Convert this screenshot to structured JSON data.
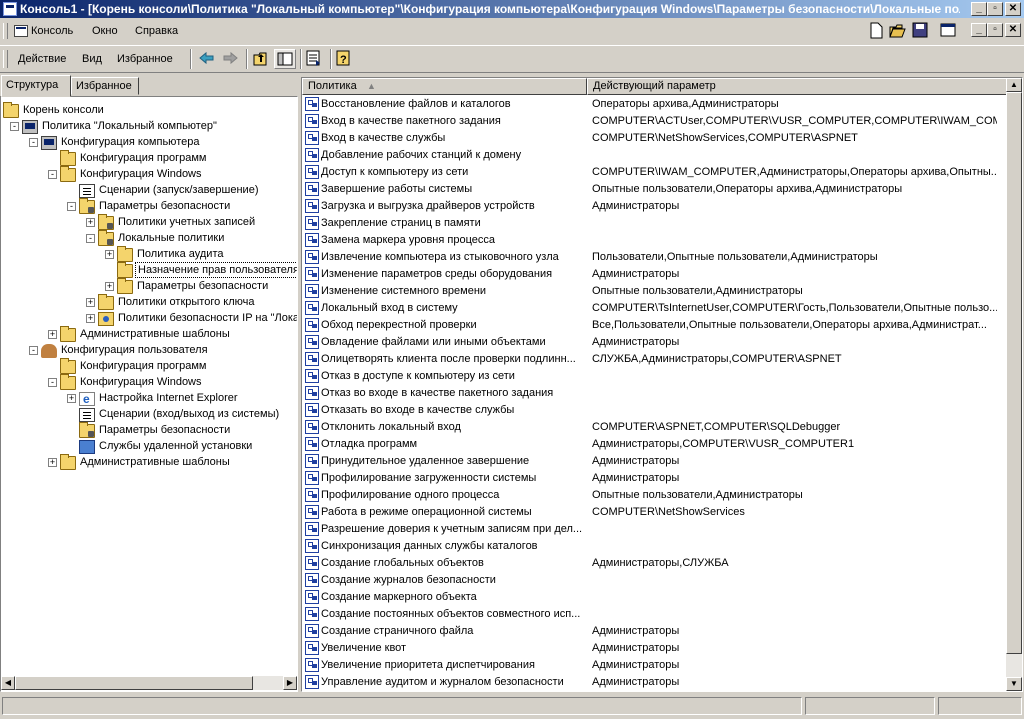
{
  "window": {
    "title": "Консоль1 - [Корень консоли\\Политика \"Локальный компьютер\"\\Конфигурация компьютера\\Конфигурация Windows\\Параметры безопасности\\Локальные пол..."
  },
  "menu": {
    "console": "Консоль",
    "window": "Окно",
    "help": "Справка"
  },
  "toolbar": {
    "action": "Действие",
    "view": "Вид",
    "favorites": "Избранное"
  },
  "tabs": {
    "structure": "Структура",
    "favorites": "Избранное"
  },
  "tree": [
    {
      "label": "Корень консоли",
      "icon": "folder-icon",
      "expander": ""
    },
    {
      "label": "Политика \"Локальный компьютер\"",
      "icon": "computer-icon",
      "expander": "-"
    },
    {
      "label": "Конфигурация компьютера",
      "icon": "computer-icon",
      "expander": "-"
    },
    {
      "label": "Конфигурация программ",
      "icon": "folder-icon",
      "expander": ""
    },
    {
      "label": "Конфигурация Windows",
      "icon": "folder-icon",
      "expander": "-"
    },
    {
      "label": "Сценарии (запуск/завершение)",
      "icon": "script-icon",
      "expander": ""
    },
    {
      "label": "Параметры безопасности",
      "icon": "security-folder-icon",
      "expander": "-"
    },
    {
      "label": "Политики учетных записей",
      "icon": "security-folder-icon",
      "expander": "+"
    },
    {
      "label": "Локальные политики",
      "icon": "security-folder-icon",
      "expander": "-"
    },
    {
      "label": "Политика аудита",
      "icon": "folder-icon",
      "expander": "+"
    },
    {
      "label": "Назначение прав пользователя",
      "icon": "folder-icon",
      "expander": "",
      "selected": true
    },
    {
      "label": "Параметры безопасности",
      "icon": "folder-icon",
      "expander": "+"
    },
    {
      "label": "Политики открытого ключа",
      "icon": "folder-icon",
      "expander": "+"
    },
    {
      "label": "Политики безопасности IP на \"Лока",
      "icon": "ipsec-icon",
      "expander": "+"
    },
    {
      "label": "Административные шаблоны",
      "icon": "folder-icon",
      "expander": "+"
    },
    {
      "label": "Конфигурация пользователя",
      "icon": "user-icon",
      "expander": "-"
    },
    {
      "label": "Конфигурация программ",
      "icon": "folder-icon",
      "expander": ""
    },
    {
      "label": "Конфигурация Windows",
      "icon": "folder-icon",
      "expander": "-"
    },
    {
      "label": "Настройка Internet Explorer",
      "icon": "ie-icon",
      "expander": "+"
    },
    {
      "label": "Сценарии (вход/выход из системы)",
      "icon": "script-icon",
      "expander": ""
    },
    {
      "label": "Параметры безопасности",
      "icon": "security-folder-icon",
      "expander": ""
    },
    {
      "label": "Службы удаленной установки",
      "icon": "network-icon",
      "expander": ""
    },
    {
      "label": "Административные шаблоны",
      "icon": "folder-icon",
      "expander": "+"
    }
  ],
  "list": {
    "col_policy": "Политика",
    "col_value": "Действующий параметр",
    "rows": [
      {
        "policy": "Восстановление файлов и каталогов",
        "value": "Операторы архива,Администраторы"
      },
      {
        "policy": "Вход в качестве пакетного задания",
        "value": "COMPUTER\\ACTUser,COMPUTER\\VUSR_COMPUTER,COMPUTER\\IWAM_COMPUT..."
      },
      {
        "policy": "Вход в качестве службы",
        "value": "COMPUTER\\NetShowServices,COMPUTER\\ASPNET"
      },
      {
        "policy": "Добавление рабочих станций к домену",
        "value": ""
      },
      {
        "policy": "Доступ к компьютеру из сети",
        "value": "COMPUTER\\IWAM_COMPUTER,Администраторы,Операторы архива,Опытны..."
      },
      {
        "policy": "Завершение работы системы",
        "value": "Опытные пользователи,Операторы архива,Администраторы"
      },
      {
        "policy": "Загрузка и выгрузка драйверов устройств",
        "value": "Администраторы"
      },
      {
        "policy": "Закрепление страниц в памяти",
        "value": ""
      },
      {
        "policy": "Замена маркера уровня процесса",
        "value": ""
      },
      {
        "policy": "Извлечение компьютера из стыковочного узла",
        "value": "Пользователи,Опытные пользователи,Администраторы"
      },
      {
        "policy": "Изменение параметров среды оборудования",
        "value": "Администраторы"
      },
      {
        "policy": "Изменение системного времени",
        "value": "Опытные пользователи,Администраторы"
      },
      {
        "policy": "Локальный вход в систему",
        "value": "COMPUTER\\TsInternetUser,COMPUTER\\Гость,Пользователи,Опытные пользо..."
      },
      {
        "policy": "Обход перекрестной проверки",
        "value": "Все,Пользователи,Опытные пользователи,Операторы архива,Администрат..."
      },
      {
        "policy": "Овладение файлами или иными объектами",
        "value": "Администраторы"
      },
      {
        "policy": "Олицетворять клиента после проверки подлинн...",
        "value": "СЛУЖБА,Администраторы,COMPUTER\\ASPNET"
      },
      {
        "policy": "Отказ в доступе к компьютеру из сети",
        "value": ""
      },
      {
        "policy": "Отказ во входе в качестве пакетного задания",
        "value": ""
      },
      {
        "policy": "Отказать во входе в качестве службы",
        "value": ""
      },
      {
        "policy": "Отклонить локальный вход",
        "value": "COMPUTER\\ASPNET,COMPUTER\\SQLDebugger"
      },
      {
        "policy": "Отладка программ",
        "value": "Администраторы,COMPUTER\\VUSR_COMPUTER1"
      },
      {
        "policy": "Принудительное удаленное завершение",
        "value": "Администраторы"
      },
      {
        "policy": "Профилирование загруженности системы",
        "value": "Администраторы"
      },
      {
        "policy": "Профилирование одного процесса",
        "value": "Опытные пользователи,Администраторы"
      },
      {
        "policy": "Работа в режиме операционной системы",
        "value": "COMPUTER\\NetShowServices"
      },
      {
        "policy": "Разрешение доверия к учетным записям при дел...",
        "value": ""
      },
      {
        "policy": "Синхронизация данных службы каталогов",
        "value": ""
      },
      {
        "policy": "Создание глобальных объектов",
        "value": "Администраторы,СЛУЖБА"
      },
      {
        "policy": "Создание журналов безопасности",
        "value": ""
      },
      {
        "policy": "Создание маркерного объекта",
        "value": ""
      },
      {
        "policy": "Создание постоянных объектов совместного исп...",
        "value": ""
      },
      {
        "policy": "Создание страничного файла",
        "value": "Администраторы"
      },
      {
        "policy": "Увеличение квот",
        "value": "Администраторы"
      },
      {
        "policy": "Увеличение приоритета диспетчирования",
        "value": "Администраторы"
      },
      {
        "policy": "Управление аудитом и журналом безопасности",
        "value": "Администраторы"
      }
    ]
  }
}
